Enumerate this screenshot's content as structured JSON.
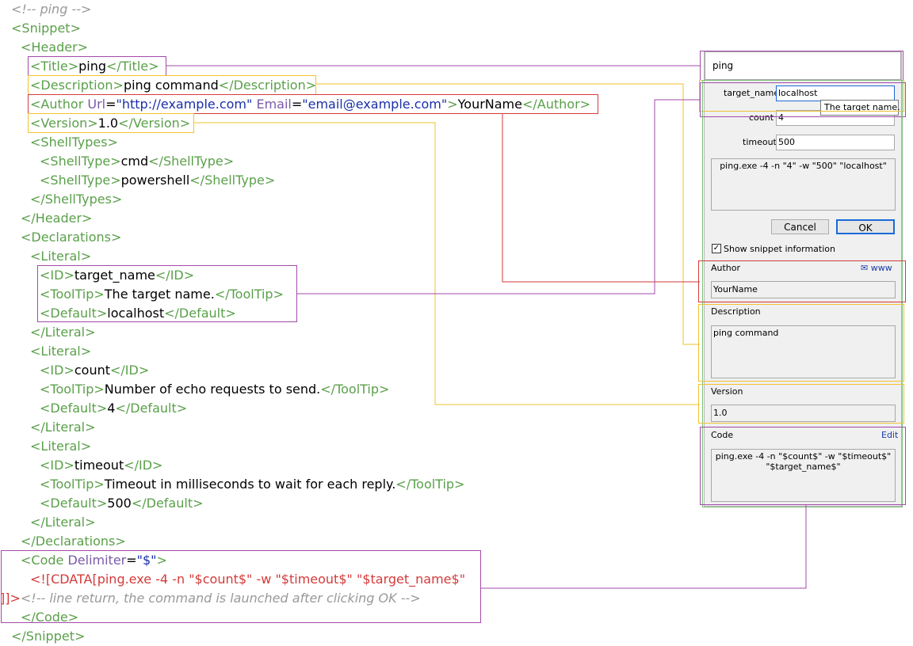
{
  "xml": {
    "l0": "<!-- ping -->",
    "snippet_open": "<Snippet>",
    "header_open": "<Header>",
    "title_open": "<Title>",
    "title_val": "ping",
    "title_close": "</Title>",
    "desc_open": "<Description>",
    "desc_val": "ping command",
    "desc_close": "</Description>",
    "author_open": "<Author ",
    "author_url_attr": "Url",
    "author_url_val": "\"http://example.com\"",
    "author_email_attr": "Email",
    "author_email_val": "\"email@example.com\"",
    "author_gt": ">",
    "author_val": "YourName",
    "author_close": "</Author>",
    "version_open": "<Version>",
    "version_val": "1.0",
    "version_close": "</Version>",
    "shelltypes_open": "<ShellTypes>",
    "shell1_open": "<ShellType>",
    "shell1_val": "cmd",
    "shell1_close": "</ShellType>",
    "shell2_open": "<ShellType>",
    "shell2_val": "powershell",
    "shell2_close": "</ShellType>",
    "shelltypes_close": "</ShellTypes>",
    "header_close": "</Header>",
    "decl_open": "<Declarations>",
    "literal_open": "<Literal>",
    "literal_close": "</Literal>",
    "id_open": "<ID>",
    "id_close": "</ID>",
    "tt_open": "<ToolTip>",
    "tt_close": "</ToolTip>",
    "def_open": "<Default>",
    "def_close": "</Default>",
    "lit1": {
      "id": "target_name",
      "tooltip": "The target name.",
      "default": "localhost"
    },
    "lit2": {
      "id": "count",
      "tooltip": "Number of echo requests to send.",
      "default": "4"
    },
    "lit3": {
      "id": "timeout",
      "tooltip": "Timeout in milliseconds to wait for each reply.",
      "default": "500"
    },
    "decl_close": "</Declarations>",
    "code_open": "<Code ",
    "code_attr": "Delimiter",
    "code_attr_val": "\"$\"",
    "code_gt": ">",
    "cdata_line": "<![CDATA[ping.exe -4 -n \"$count$\" -w \"$timeout$\" \"$target_name$\"",
    "cdata_end": "]]>",
    "cdata_comment": "<!-- line return, the command is launched after clicking OK -->",
    "code_close": "</Code>",
    "snippet_close": "</Snippet>"
  },
  "dialog": {
    "title": "ping",
    "fields": {
      "target_name_label": "target_name",
      "target_name_value": "localhost",
      "count_label": "count",
      "count_value": "4",
      "timeout_label": "timeout",
      "timeout_value": "500"
    },
    "tooltip": "The target name.",
    "preview": "ping.exe -4 -n \"4\" -w \"500\" \"localhost\"",
    "cancel": "Cancel",
    "ok": "OK",
    "show_info": "Show snippet information",
    "author_label": "Author",
    "author_links": "✉ www",
    "author_value": "YourName",
    "description_label": "Description",
    "description_value": "ping command",
    "version_label": "Version",
    "version_value": "1.0",
    "code_label": "Code",
    "code_edit": "Edit",
    "code_value": "ping.exe -4 -n \"$count$\" -w \"$timeout$\"\n\"$target_name$\""
  },
  "colors": {
    "purple": "#a24aa8",
    "yellow": "#f1c232",
    "red": "#d43a3a",
    "green": "#7fc07a"
  }
}
